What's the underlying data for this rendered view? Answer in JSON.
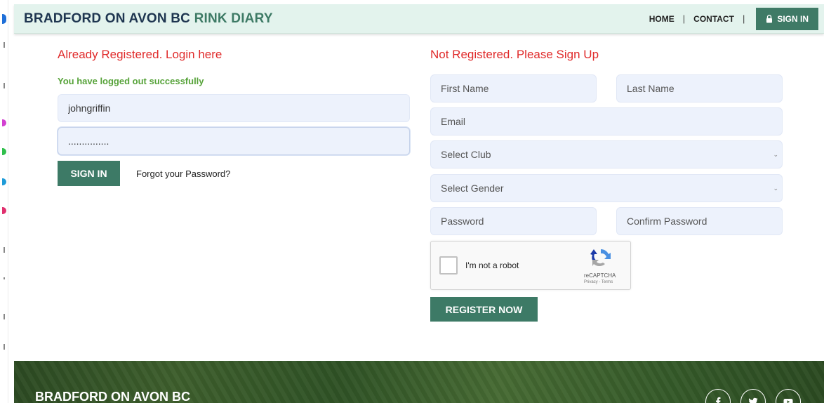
{
  "header": {
    "brand_main": "BRADFORD ON AVON BC ",
    "brand_accent": "RINK DIARY",
    "nav": {
      "home": "HOME",
      "contact": "CONTACT",
      "separator": "|",
      "signin": "SIGN IN"
    }
  },
  "login": {
    "title": "Already Registered. Login here",
    "success_message": "You have logged out successfully",
    "username_value": "johngriffin",
    "password_value": "...............",
    "signin_button": "SIGN IN",
    "forgot_link": "Forgot your Password?"
  },
  "register": {
    "title": "Not Registered. Please Sign Up",
    "first_name_placeholder": "First Name",
    "last_name_placeholder": "Last Name",
    "email_placeholder": "Email",
    "club_select": "Select Club",
    "gender_select": "Select Gender",
    "password_placeholder": "Password",
    "confirm_password_placeholder": "Confirm Password",
    "register_button": "REGISTER NOW"
  },
  "recaptcha": {
    "label": "I'm not a robot",
    "brand": "reCAPTCHA",
    "terms": "Privacy - Terms"
  },
  "footer": {
    "brand": "BRADFORD ON AVON BC",
    "social": [
      "facebook-icon",
      "twitter-icon",
      "youtube-icon"
    ]
  },
  "colors": {
    "accent_green": "#3d7a66",
    "title_red": "#e02b2b",
    "success_green": "#57a33a",
    "header_bg": "#e3f3ed",
    "field_bg": "#edf2fc"
  }
}
